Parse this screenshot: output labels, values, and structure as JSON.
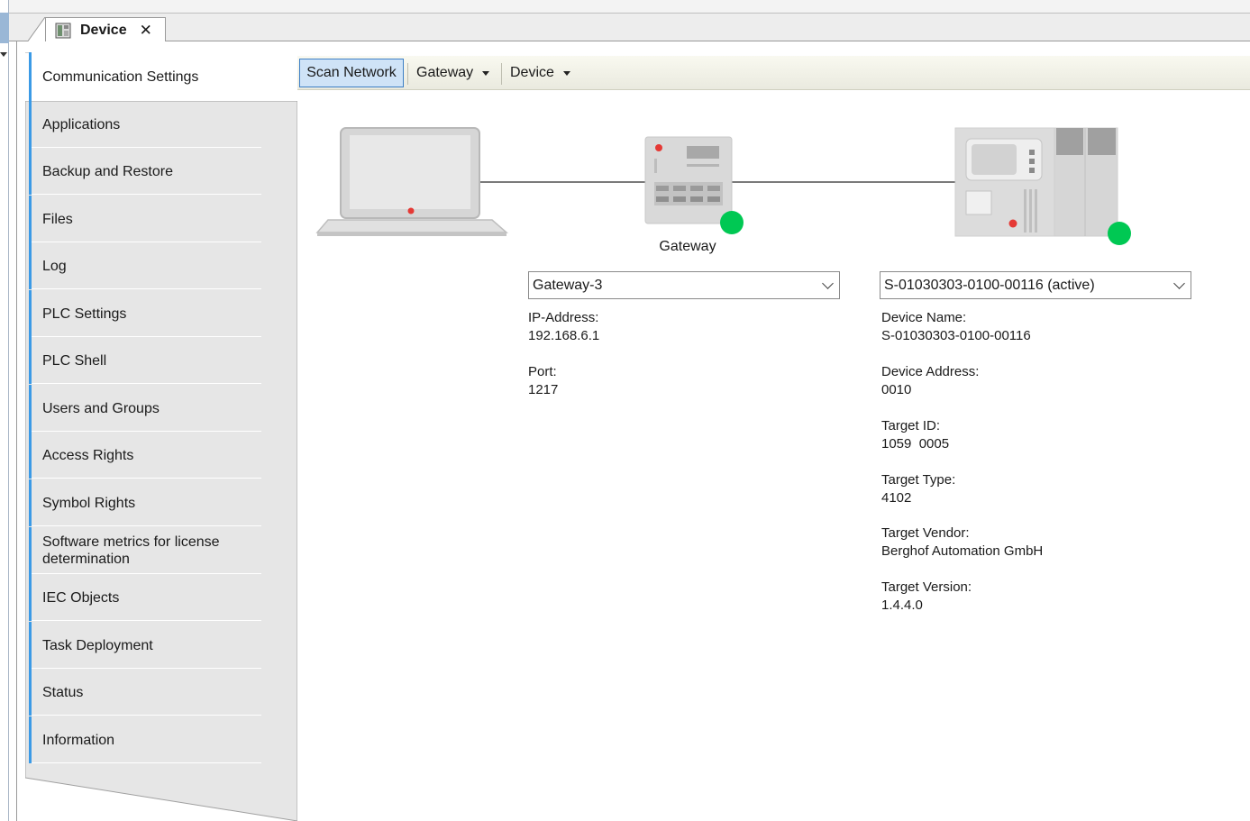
{
  "tab": {
    "title": "Device",
    "close": "✕"
  },
  "sidebar": {
    "items": [
      {
        "label": "Communication Settings"
      },
      {
        "label": "Applications"
      },
      {
        "label": "Backup and Restore"
      },
      {
        "label": "Files"
      },
      {
        "label": "Log"
      },
      {
        "label": "PLC Settings"
      },
      {
        "label": "PLC Shell"
      },
      {
        "label": "Users and Groups"
      },
      {
        "label": "Access Rights"
      },
      {
        "label": "Symbol Rights"
      },
      {
        "label": "Software metrics for license determination"
      },
      {
        "label": "IEC Objects"
      },
      {
        "label": "Task Deployment"
      },
      {
        "label": "Status"
      },
      {
        "label": "Information"
      }
    ]
  },
  "toolbar": {
    "scan_label": "Scan Network",
    "gateway_label": "Gateway",
    "device_label": "Device"
  },
  "gateway": {
    "caption": "Gateway",
    "selected": "Gateway-3",
    "ip_label": "IP-Address:",
    "ip_value": "192.168.6.1",
    "port_label": "Port:",
    "port_value": "1217"
  },
  "device": {
    "selected": "S-01030303-0100-00116 (active)",
    "name_label": "Device Name:",
    "name_value": "S-01030303-0100-00116",
    "address_label": "Device Address:",
    "address_value": "0010",
    "target_id_label": "Target ID:",
    "target_id_value": "1059  0005",
    "target_type_label": "Target Type:",
    "target_type_value": "4102",
    "target_vendor_label": "Target Vendor:",
    "target_vendor_value": "Berghof Automation GmbH",
    "target_version_label": "Target Version:",
    "target_version_value": "1.4.4.0"
  },
  "colors": {
    "accent": "#3b9ae6",
    "status_online": "#00c853",
    "led_red": "#e53935",
    "scan_button_bg": "#cfe3f7"
  }
}
